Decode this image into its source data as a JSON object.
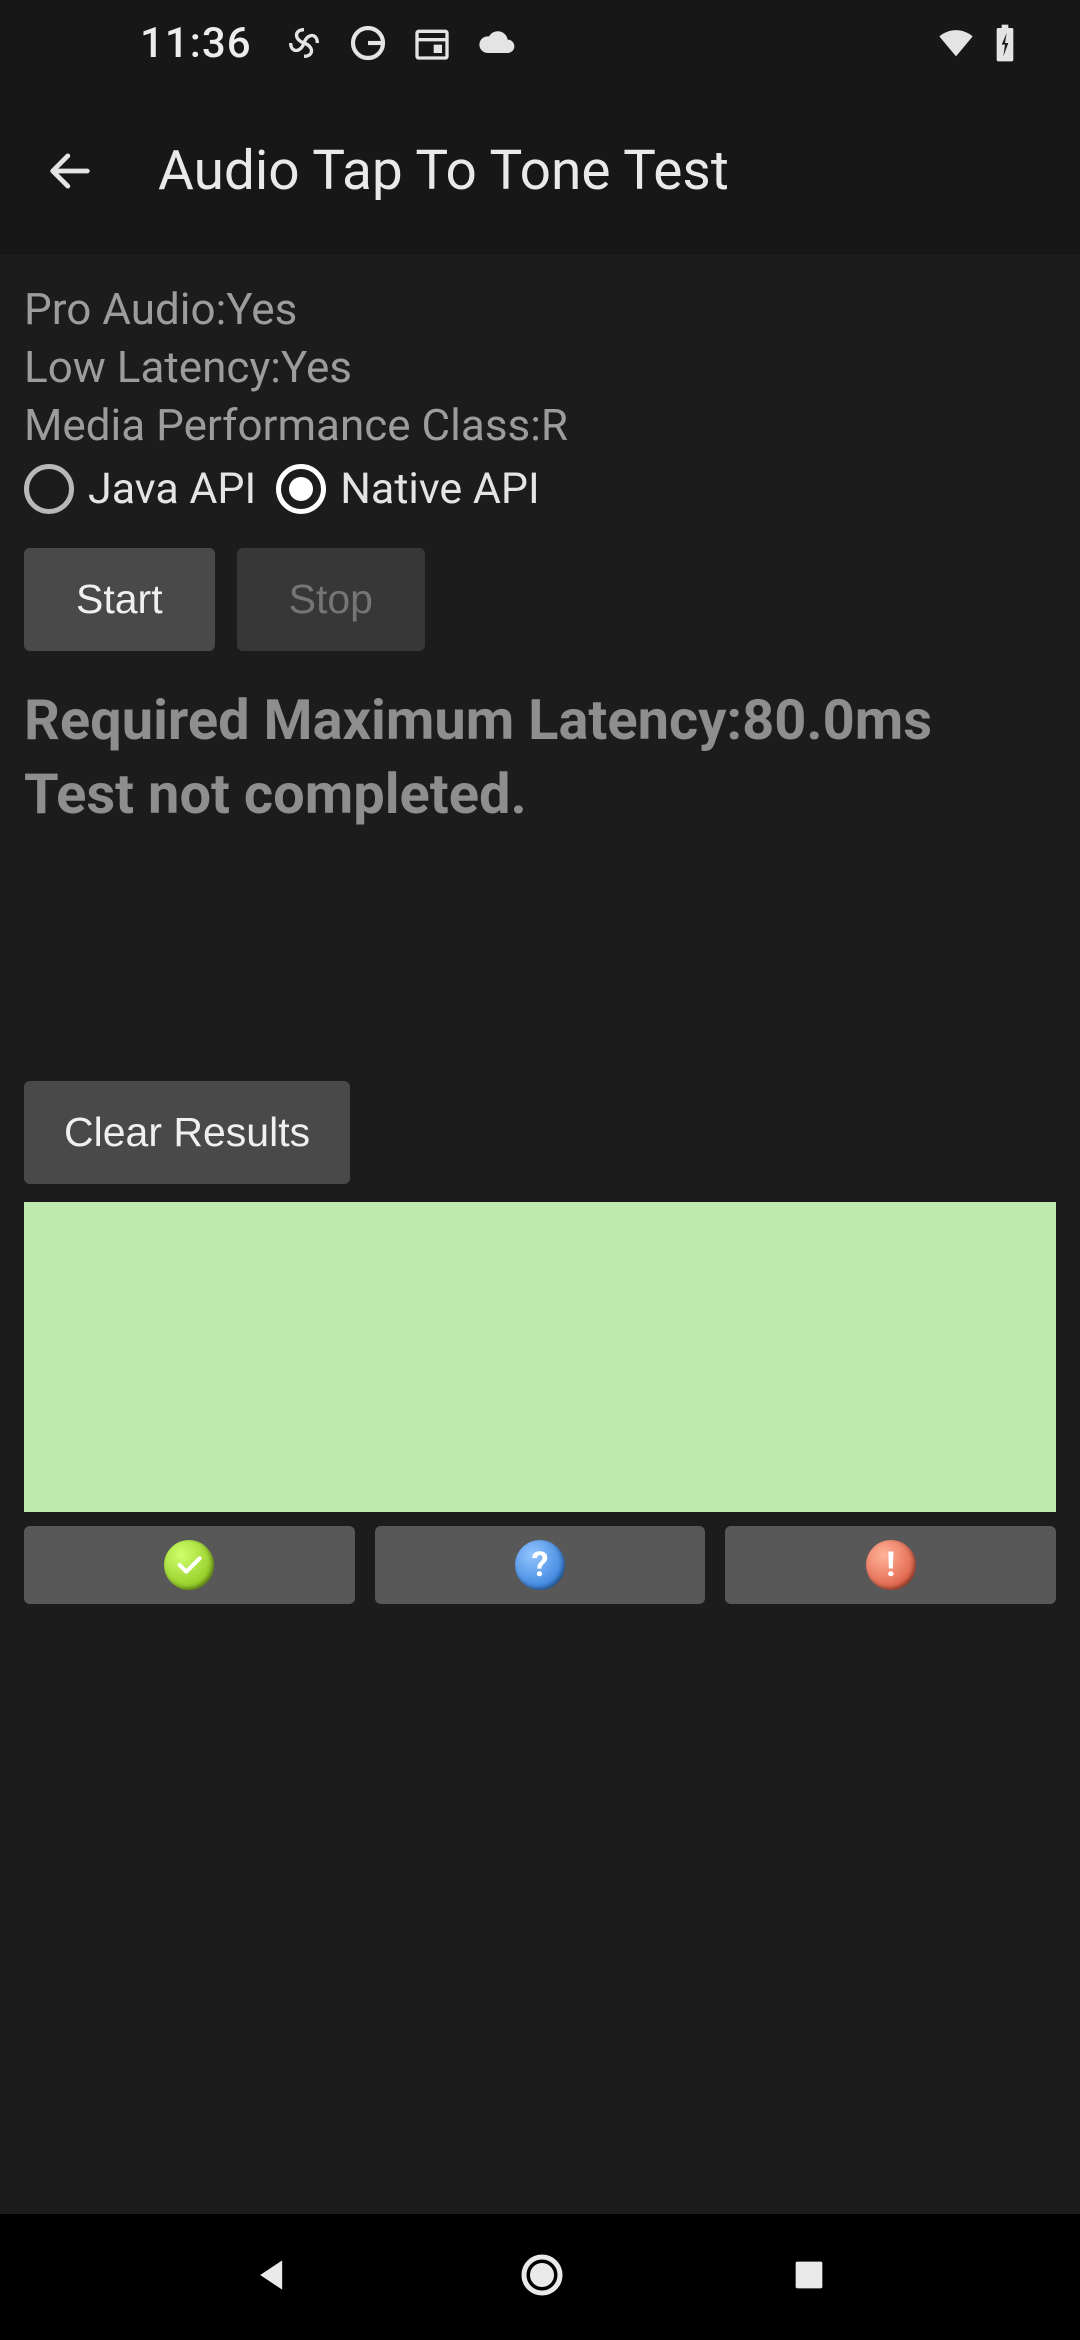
{
  "status_bar": {
    "time": "11:36",
    "icons_left": [
      "pinwheel-icon",
      "google-icon",
      "calendar-icon",
      "cloud-icon"
    ],
    "icons_right": [
      "wifi-icon",
      "battery-charging-icon"
    ]
  },
  "app_bar": {
    "title": "Audio Tap To Tone Test"
  },
  "info": {
    "pro_audio": "Pro Audio:Yes",
    "low_latency": "Low Latency:Yes",
    "media_perf_class": "Media Performance Class:R"
  },
  "api_radio": {
    "java_label": "Java API",
    "native_label": "Native API",
    "selected": "native"
  },
  "buttons": {
    "start": "Start",
    "stop": "Stop",
    "clear": "Clear Results"
  },
  "status": {
    "line1": "Required Maximum Latency:80.0ms",
    "line2": "Test not completed."
  },
  "result_panel": {
    "color": "#beeaaf"
  },
  "result_buttons": {
    "pass": "pass-icon",
    "help": "help-icon",
    "fail": "fail-icon"
  }
}
